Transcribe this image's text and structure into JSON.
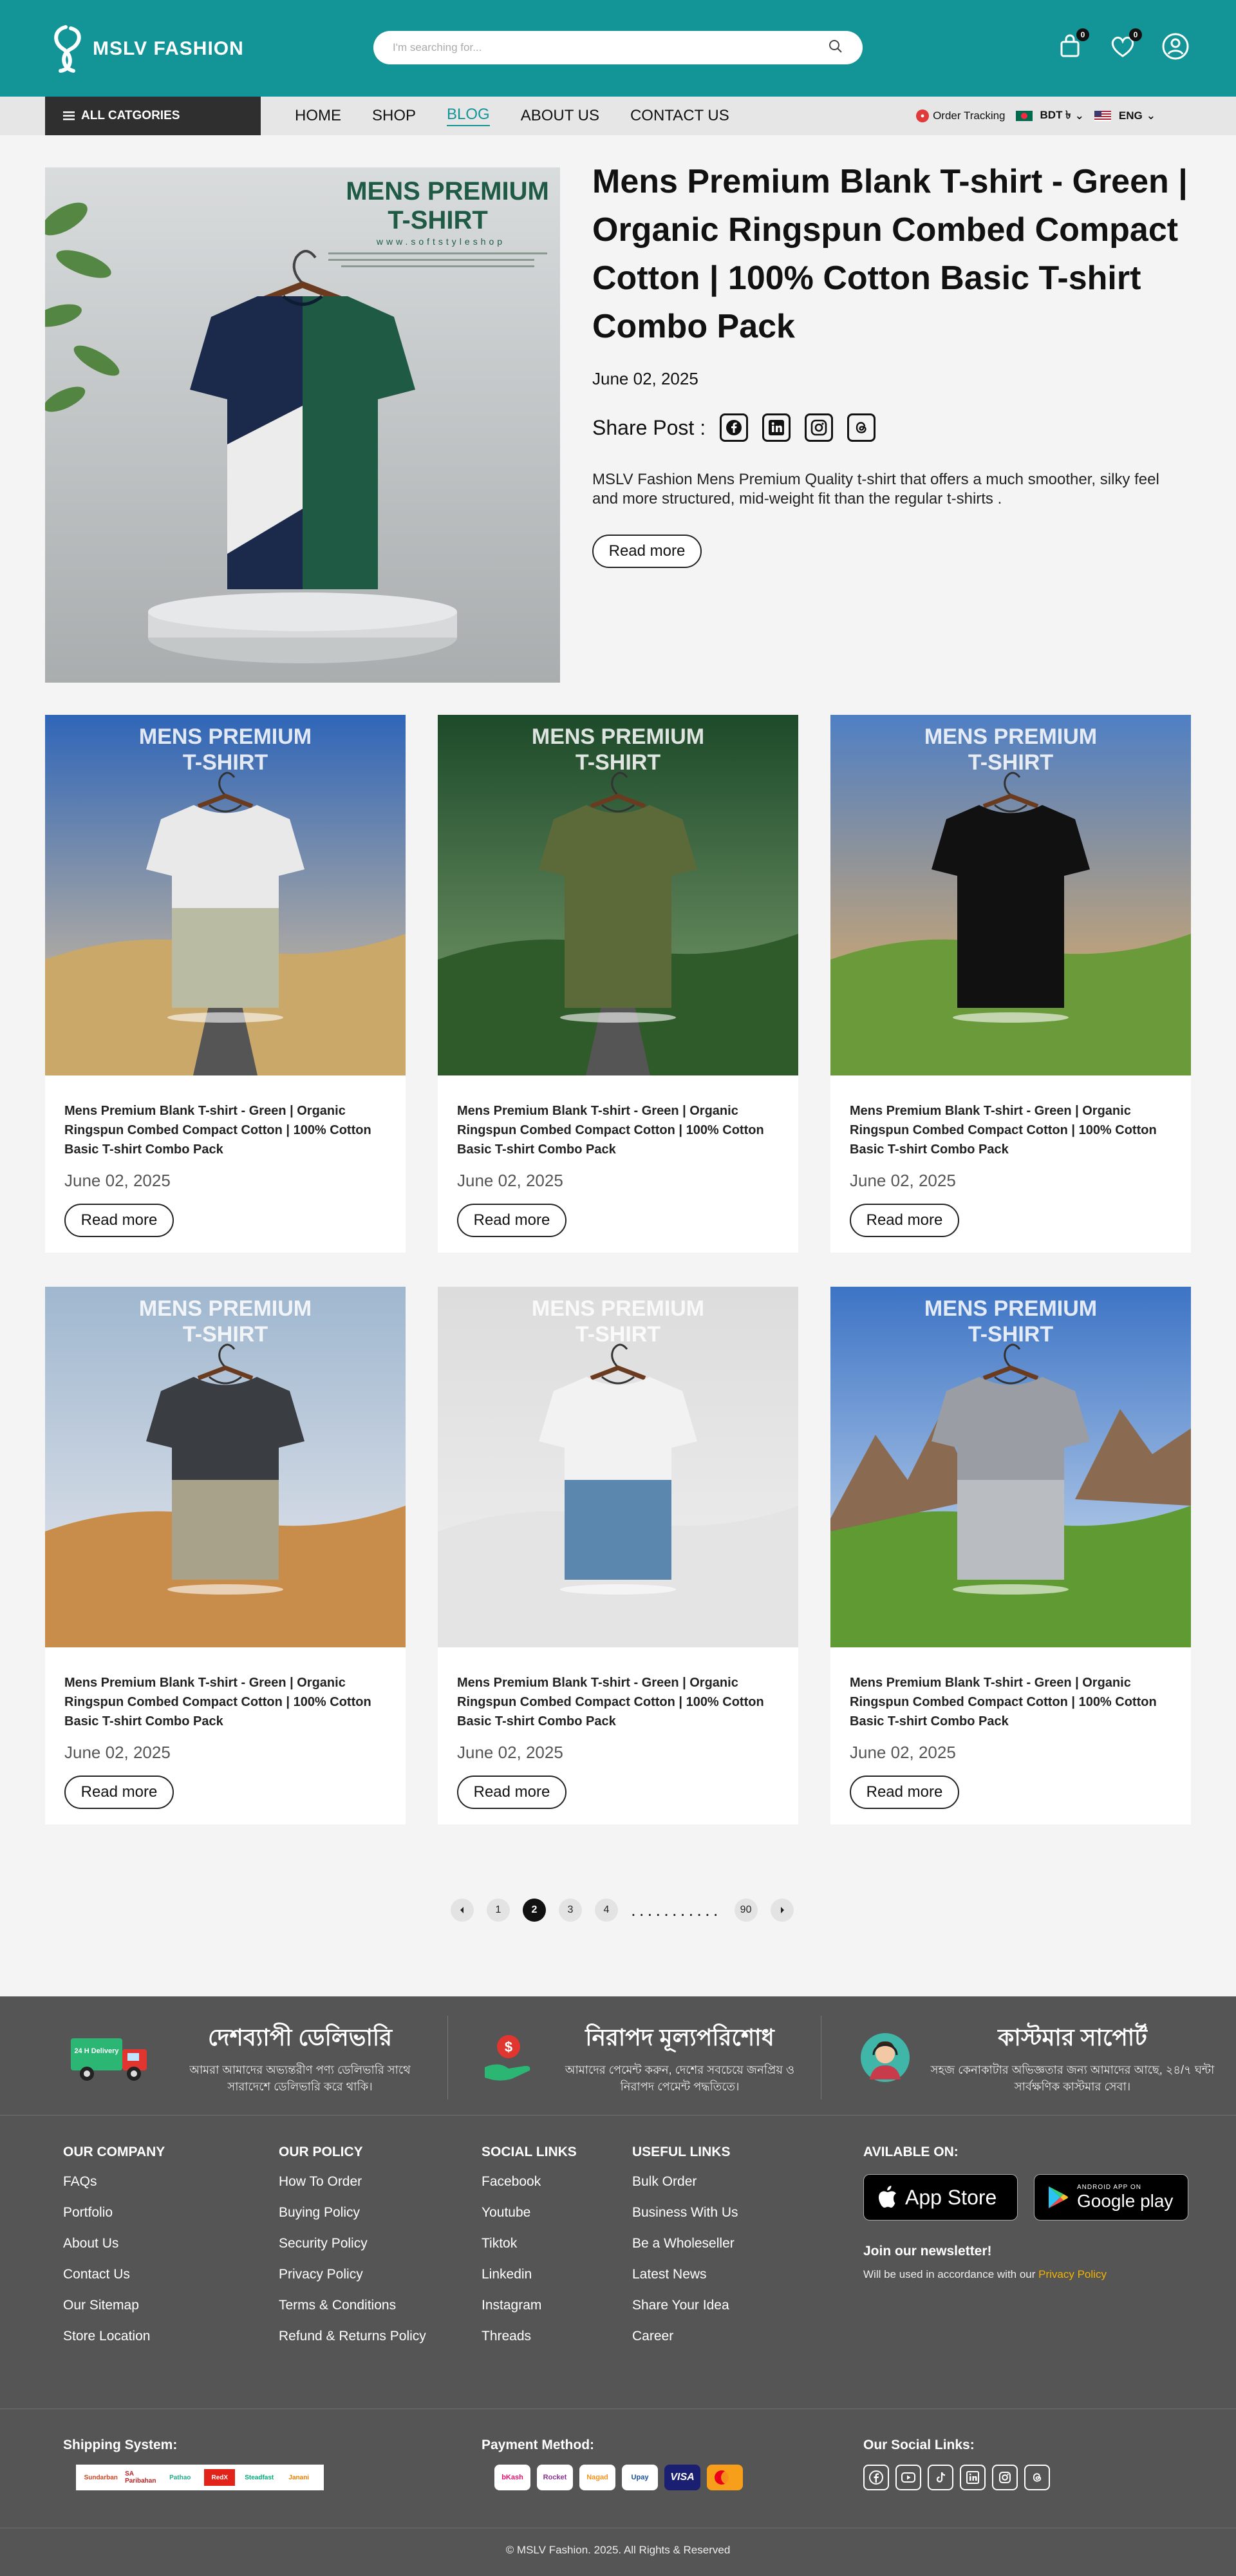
{
  "header": {
    "logo_text": "MSLV FASHION",
    "search_placeholder": "I'm searching for...",
    "cart_count": "0",
    "wishlist_count": "0"
  },
  "nav": {
    "all_categories": "ALL CATGORIES",
    "menu": [
      "HOME",
      "SHOP",
      "BLOG",
      "ABOUT US",
      "CONTACT US"
    ],
    "active_menu": "BLOG",
    "order_tracking": "Order Tracking",
    "currency": "BDT ৳",
    "language": "ENG"
  },
  "featured": {
    "title": "Mens Premium Blank T-shirt - Green | Organic Ringspun Combed Compact Cotton | 100% Cotton Basic T-shirt Combo Pack",
    "date": "June 02, 2025",
    "share_label": "Share Post :",
    "share_icons": [
      "facebook-icon",
      "linkedin-icon",
      "instagram-icon",
      "threads-icon"
    ],
    "excerpt": "MSLV Fashion Mens Premium Quality t-shirt that offers a much smoother, silky feel and more structured, mid-weight fit than the regular t-shirts .",
    "read_more": "Read more",
    "image": {
      "poster_title_line1": "MENS PREMIUM",
      "poster_title_line2": "T-SHIRT",
      "poster_url": "www.softstyleshop",
      "colors": [
        "#1b2a4a",
        "#1f5a45",
        "#e8e8e8"
      ]
    }
  },
  "posts": [
    {
      "title": "Mens Premium Blank T-shirt - Green | Organic Ringspun Combed Compact Cotton | 100% Cotton Basic T-shirt Combo Pack",
      "date": "June 02, 2025",
      "read_more": "Read more",
      "poster_l1": "MENS PREMIUM",
      "poster_l2": "T-SHIRT",
      "scene": "road",
      "shirt_top": "#e9e9e9",
      "shirt_bottom": "#b9bca3"
    },
    {
      "title": "Mens Premium Blank T-shirt - Green | Organic Ringspun Combed Compact Cotton | 100% Cotton Basic T-shirt Combo Pack",
      "date": "June 02, 2025",
      "read_more": "Read more",
      "poster_l1": "MENS PREMIUM",
      "poster_l2": "T-SHIRT",
      "scene": "forest",
      "shirt_top": "#5c6a3a",
      "shirt_bottom": "#5c6a3a"
    },
    {
      "title": "Mens Premium Blank T-shirt - Green | Organic Ringspun Combed Compact Cotton | 100% Cotton Basic T-shirt Combo Pack",
      "date": "June 02, 2025",
      "read_more": "Read more",
      "poster_l1": "MENS PREMIUM",
      "poster_l2": "T-SHIRT",
      "scene": "sunset",
      "shirt_top": "#111111",
      "shirt_bottom": "#111111"
    },
    {
      "title": "Mens Premium Blank T-shirt - Green | Organic Ringspun Combed Compact Cotton | 100% Cotton Basic T-shirt Combo Pack",
      "date": "June 02, 2025",
      "read_more": "Read more",
      "poster_l1": "MENS PREMIUM",
      "poster_l2": "T-SHIRT",
      "scene": "desert",
      "shirt_top": "#3a3d42",
      "shirt_bottom": "#a8a28a"
    },
    {
      "title": "Mens Premium Blank T-shirt - Green | Organic Ringspun Combed Compact Cotton | 100% Cotton Basic T-shirt Combo Pack",
      "date": "June 02, 2025",
      "read_more": "Read more",
      "poster_l1": "MENS PREMIUM",
      "poster_l2": "T-SHIRT",
      "scene": "studio",
      "shirt_top": "#f2f2f2",
      "shirt_bottom": "#5b86ad"
    },
    {
      "title": "Mens Premium Blank T-shirt - Green | Organic Ringspun Combed Compact Cotton | 100% Cotton Basic T-shirt Combo Pack",
      "date": "June 02, 2025",
      "read_more": "Read more",
      "poster_l1": "MENS PREMIUM",
      "poster_l2": "T-SHIRT",
      "scene": "mountain",
      "shirt_top": "#9a9ea4",
      "shirt_bottom": "#b9bcc1"
    }
  ],
  "pagination": {
    "pages": [
      "1",
      "2",
      "3",
      "4"
    ],
    "active": "2",
    "dots": "...........",
    "last": "90"
  },
  "footer": {
    "features": [
      {
        "title": "দেশব্যাপী ডেলিভারি",
        "desc": "আমরা আমাদের অভ্যন্তরীণ পণ্য ডেলিভারি সাথে সারাদেশে ডেলিভারি করে থাকি।",
        "icon": "delivery-truck-icon",
        "badge": "24 H Delivery"
      },
      {
        "title": "নিরাপদ মূল্যপরিশোধ",
        "desc": "আমাদের পেমেন্ট করুন, দেশের সবচেয়ে জনপ্রিয় ও নিরাপদ পেমেন্ট পদ্ধতিতে।",
        "icon": "secure-payment-icon"
      },
      {
        "title": "কাস্টমার সাপোর্ট",
        "desc": "সহজ কেনাকাটার অভিজ্ঞতার জন্য আমাদের আছে, ২৪/৭ ঘন্টা সার্বক্ষণিক কাস্টমার সেবা।",
        "icon": "customer-support-icon"
      }
    ],
    "company": {
      "heading": "OUR COMPANY",
      "links": [
        "FAQs",
        "Portfolio",
        "About Us",
        "Contact Us",
        "Our Sitemap",
        "Store Location"
      ]
    },
    "policy": {
      "heading": "OUR POLICY",
      "links": [
        "How To Order",
        "Buying Policy",
        "Security Policy",
        "Privacy Policy",
        "Terms & Conditions",
        "Refund & Returns Policy"
      ]
    },
    "social": {
      "heading": "SOCIAL LINKS",
      "links": [
        "Facebook",
        "Youtube",
        "Tiktok",
        "Linkedin",
        "Instagram",
        "Threads"
      ]
    },
    "useful": {
      "heading": "USEFUL LINKS",
      "links": [
        "Bulk Order",
        "Business With Us",
        "Be a Wholeseller",
        "Latest News",
        "Share Your Idea",
        "Career"
      ]
    },
    "available": {
      "heading": "AVILABLE ON:",
      "appstore": "App Store",
      "googleplay_small": "ANDROID APP ON",
      "googleplay": "Google play"
    },
    "newsletter": {
      "heading": "Join our newsletter!",
      "text": "Will be used in accordance with our ",
      "link": "Privacy Policy"
    },
    "shipping": {
      "heading": "Shipping System:",
      "logos": [
        "Sundarban",
        "SA Paribahan",
        "Pathao",
        "RedX",
        "Steadfast",
        "Janani"
      ]
    },
    "payment": {
      "heading": "Payment Method:",
      "logos": [
        "bKash",
        "Rocket",
        "Nagad",
        "Upay",
        "VISA",
        "Mastercard"
      ]
    },
    "social_icons": {
      "heading": "Our Social Links:",
      "icons": [
        "facebook-icon",
        "youtube-icon",
        "tiktok-icon",
        "linkedin-icon",
        "instagram-icon",
        "threads-icon"
      ]
    },
    "copyright": "© MSLV Fashion. 2025. All Rights & Reserved"
  }
}
